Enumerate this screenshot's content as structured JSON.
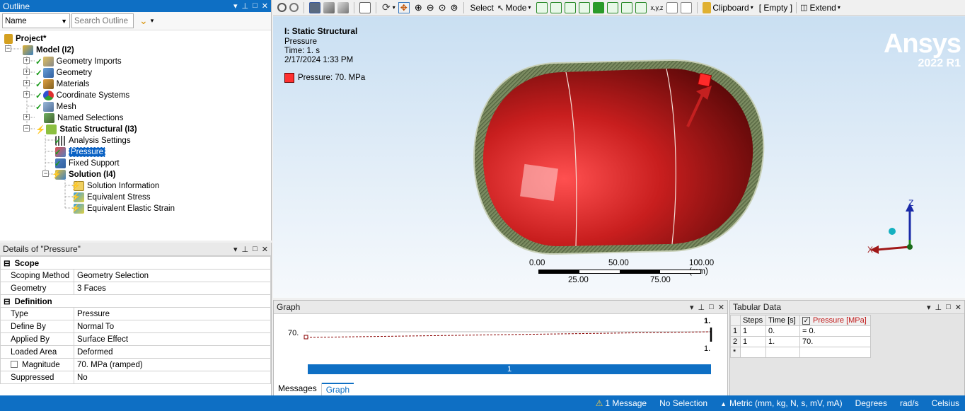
{
  "outline": {
    "title": "Outline",
    "name_field": "Name",
    "search_placeholder": "Search Outline",
    "tree": [
      {
        "label": "Project*",
        "bold": true
      },
      {
        "label": "Model (I2)",
        "bold": true
      },
      {
        "label": "Geometry Imports"
      },
      {
        "label": "Geometry"
      },
      {
        "label": "Materials"
      },
      {
        "label": "Coordinate Systems"
      },
      {
        "label": "Mesh"
      },
      {
        "label": "Named Selections"
      },
      {
        "label": "Static Structural (I3)",
        "bold": true
      },
      {
        "label": "Analysis Settings"
      },
      {
        "label": "Pressure",
        "selected": true
      },
      {
        "label": "Fixed Support"
      },
      {
        "label": "Solution (I4)",
        "bold": true
      },
      {
        "label": "Solution Information"
      },
      {
        "label": "Equivalent Stress"
      },
      {
        "label": "Equivalent Elastic Strain"
      }
    ]
  },
  "details": {
    "title": "Details of \"Pressure\"",
    "groups": [
      {
        "name": "Scope",
        "rows": [
          {
            "key": "Scoping Method",
            "value": "Geometry Selection"
          },
          {
            "key": "Geometry",
            "value": "3 Faces"
          }
        ]
      },
      {
        "name": "Definition",
        "rows": [
          {
            "key": "Type",
            "value": "Pressure"
          },
          {
            "key": "Define By",
            "value": "Normal To"
          },
          {
            "key": "Applied By",
            "value": "Surface Effect"
          },
          {
            "key": "Loaded Area",
            "value": "Deformed"
          },
          {
            "key": "Magnitude",
            "value": "70. MPa  (ramped)"
          },
          {
            "key": "Suppressed",
            "value": "No"
          }
        ]
      }
    ]
  },
  "toolbar": {
    "select_label": "Select",
    "mode_label": "Mode",
    "clipboard_label": "Clipboard",
    "empty_label": "[ Empty ]",
    "extend_label": "Extend"
  },
  "viewport": {
    "analysis_title": "I: Static Structural",
    "subtitle": "Pressure",
    "time": "Time: 1. s",
    "date": "2/17/2024 1:33 PM",
    "legend": "Pressure: 70. MPa",
    "brand": "Ansys",
    "version": "2022 R1",
    "scale_top": [
      "0.00",
      "50.00",
      "100.00 (mm)"
    ],
    "scale_bottom": [
      "25.00",
      "75.00"
    ],
    "axis_z": "Z",
    "axis_x": "X",
    "colors": {
      "model_red": "#d42a2a",
      "legend_red": "#ff3030",
      "shell_green": "#6f7f55"
    }
  },
  "graph": {
    "title": "Graph",
    "y_label": "70.",
    "top_label": "1.",
    "bottom_label": "1.",
    "bar_label": "1",
    "tabs": [
      "Messages",
      "Graph"
    ]
  },
  "tabular": {
    "title": "Tabular Data",
    "headers": [
      "Steps",
      "Time [s]",
      "Pressure [MPa]"
    ],
    "rows": [
      {
        "idx": "1",
        "steps": "1",
        "time": "0.",
        "value": "= 0."
      },
      {
        "idx": "2",
        "steps": "1",
        "time": "1.",
        "value": "70."
      },
      {
        "idx": "*",
        "steps": "",
        "time": "",
        "value": ""
      }
    ]
  },
  "status": {
    "messages": "1 Message",
    "selection": "No Selection",
    "units": "Metric (mm, kg, N, s, mV, mA)",
    "angle": "Degrees",
    "rate": "rad/s",
    "temp": "Celsius"
  }
}
